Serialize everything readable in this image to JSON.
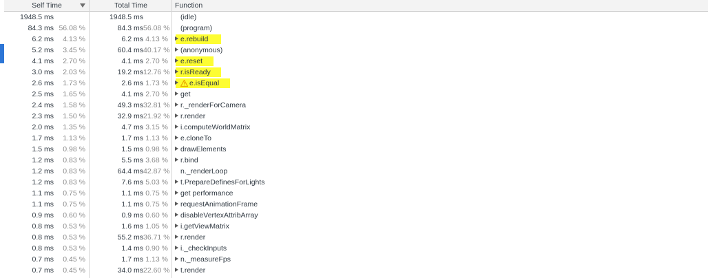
{
  "header": {
    "self_label": "Self Time",
    "total_label": "Total Time",
    "function_label": "Function"
  },
  "colors": {
    "highlight": "#fdfd32",
    "sidebar_tab": "#2d76d6",
    "warning": "#e8a500"
  },
  "rows": [
    {
      "self_ms": "1948.5 ms",
      "self_pct": "",
      "total_ms": "1948.5 ms",
      "total_pct": "",
      "fn": "(idle)",
      "expandable": false,
      "highlight": false,
      "warning": false
    },
    {
      "self_ms": "84.3 ms",
      "self_pct": "56.08 %",
      "total_ms": "84.3 ms",
      "total_pct": "56.08 %",
      "fn": "(program)",
      "expandable": false,
      "highlight": false,
      "warning": false
    },
    {
      "self_ms": "6.2 ms",
      "self_pct": "4.13 %",
      "total_ms": "6.2 ms",
      "total_pct": "4.13 %",
      "fn": "e.rebuild",
      "expandable": true,
      "highlight": true,
      "warning": false
    },
    {
      "self_ms": "5.2 ms",
      "self_pct": "3.45 %",
      "total_ms": "60.4 ms",
      "total_pct": "40.17 %",
      "fn": "(anonymous)",
      "expandable": true,
      "highlight": false,
      "warning": false
    },
    {
      "self_ms": "4.1 ms",
      "self_pct": "2.70 %",
      "total_ms": "4.1 ms",
      "total_pct": "2.70 %",
      "fn": "e.reset",
      "expandable": true,
      "highlight": true,
      "warning": false
    },
    {
      "self_ms": "3.0 ms",
      "self_pct": "2.03 %",
      "total_ms": "19.2 ms",
      "total_pct": "12.76 %",
      "fn": "r.isReady",
      "expandable": true,
      "highlight": true,
      "warning": false
    },
    {
      "self_ms": "2.6 ms",
      "self_pct": "1.73 %",
      "total_ms": "2.6 ms",
      "total_pct": "1.73 %",
      "fn": "e.isEqual",
      "expandable": true,
      "highlight": true,
      "warning": true
    },
    {
      "self_ms": "2.5 ms",
      "self_pct": "1.65 %",
      "total_ms": "4.1 ms",
      "total_pct": "2.70 %",
      "fn": "get",
      "expandable": true,
      "highlight": false,
      "warning": false
    },
    {
      "self_ms": "2.4 ms",
      "self_pct": "1.58 %",
      "total_ms": "49.3 ms",
      "total_pct": "32.81 %",
      "fn": "r._renderForCamera",
      "expandable": true,
      "highlight": false,
      "warning": false
    },
    {
      "self_ms": "2.3 ms",
      "self_pct": "1.50 %",
      "total_ms": "32.9 ms",
      "total_pct": "21.92 %",
      "fn": "r.render",
      "expandable": true,
      "highlight": false,
      "warning": false
    },
    {
      "self_ms": "2.0 ms",
      "self_pct": "1.35 %",
      "total_ms": "4.7 ms",
      "total_pct": "3.15 %",
      "fn": "i.computeWorldMatrix",
      "expandable": true,
      "highlight": false,
      "warning": false
    },
    {
      "self_ms": "1.7 ms",
      "self_pct": "1.13 %",
      "total_ms": "1.7 ms",
      "total_pct": "1.13 %",
      "fn": "e.cloneTo",
      "expandable": true,
      "highlight": false,
      "warning": false
    },
    {
      "self_ms": "1.5 ms",
      "self_pct": "0.98 %",
      "total_ms": "1.5 ms",
      "total_pct": "0.98 %",
      "fn": "drawElements",
      "expandable": true,
      "highlight": false,
      "warning": false
    },
    {
      "self_ms": "1.2 ms",
      "self_pct": "0.83 %",
      "total_ms": "5.5 ms",
      "total_pct": "3.68 %",
      "fn": "r.bind",
      "expandable": true,
      "highlight": false,
      "warning": false
    },
    {
      "self_ms": "1.2 ms",
      "self_pct": "0.83 %",
      "total_ms": "64.4 ms",
      "total_pct": "42.87 %",
      "fn": "n._renderLoop",
      "expandable": false,
      "highlight": false,
      "warning": false
    },
    {
      "self_ms": "1.2 ms",
      "self_pct": "0.83 %",
      "total_ms": "7.6 ms",
      "total_pct": "5.03 %",
      "fn": "t.PrepareDefinesForLights",
      "expandable": true,
      "highlight": false,
      "warning": false
    },
    {
      "self_ms": "1.1 ms",
      "self_pct": "0.75 %",
      "total_ms": "1.1 ms",
      "total_pct": "0.75 %",
      "fn": "get performance",
      "expandable": true,
      "highlight": false,
      "warning": false
    },
    {
      "self_ms": "1.1 ms",
      "self_pct": "0.75 %",
      "total_ms": "1.1 ms",
      "total_pct": "0.75 %",
      "fn": "requestAnimationFrame",
      "expandable": true,
      "highlight": false,
      "warning": false
    },
    {
      "self_ms": "0.9 ms",
      "self_pct": "0.60 %",
      "total_ms": "0.9 ms",
      "total_pct": "0.60 %",
      "fn": "disableVertexAttribArray",
      "expandable": true,
      "highlight": false,
      "warning": false
    },
    {
      "self_ms": "0.8 ms",
      "self_pct": "0.53 %",
      "total_ms": "1.6 ms",
      "total_pct": "1.05 %",
      "fn": "i.getViewMatrix",
      "expandable": true,
      "highlight": false,
      "warning": false
    },
    {
      "self_ms": "0.8 ms",
      "self_pct": "0.53 %",
      "total_ms": "55.2 ms",
      "total_pct": "36.71 %",
      "fn": "r.render",
      "expandable": true,
      "highlight": false,
      "warning": false
    },
    {
      "self_ms": "0.8 ms",
      "self_pct": "0.53 %",
      "total_ms": "1.4 ms",
      "total_pct": "0.90 %",
      "fn": "i._checkInputs",
      "expandable": true,
      "highlight": false,
      "warning": false
    },
    {
      "self_ms": "0.7 ms",
      "self_pct": "0.45 %",
      "total_ms": "1.7 ms",
      "total_pct": "1.13 %",
      "fn": "n._measureFps",
      "expandable": true,
      "highlight": false,
      "warning": false
    },
    {
      "self_ms": "0.7 ms",
      "self_pct": "0.45 %",
      "total_ms": "34.0 ms",
      "total_pct": "22.60 %",
      "fn": "t.render",
      "expandable": true,
      "highlight": false,
      "warning": false
    }
  ]
}
